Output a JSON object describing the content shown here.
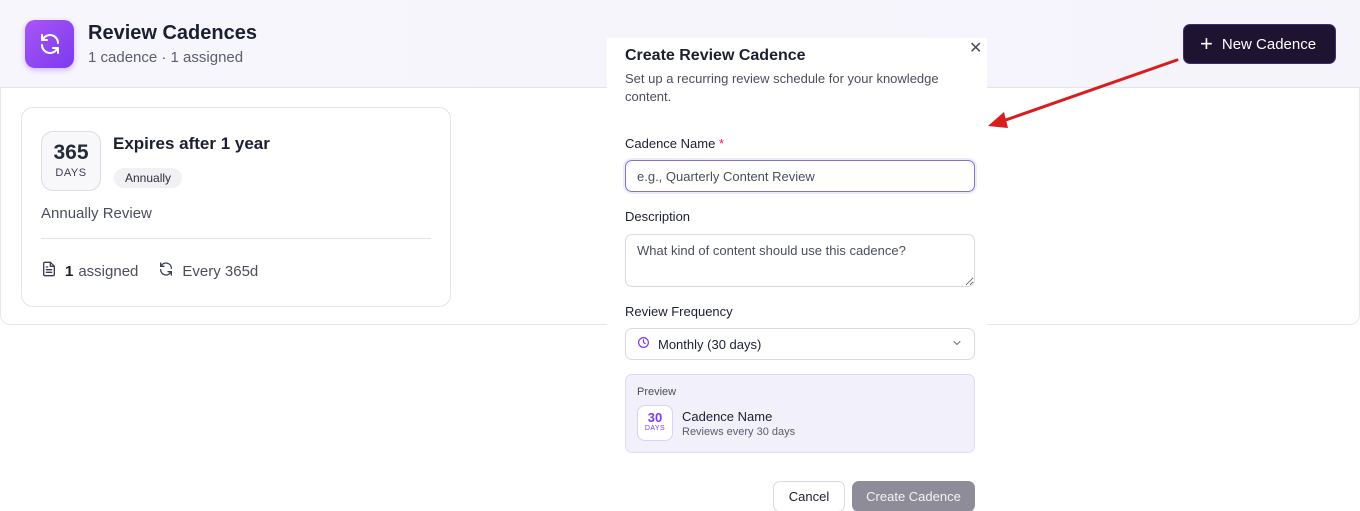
{
  "header": {
    "title": "Review Cadences",
    "subtitle": "1 cadence · 1 assigned",
    "new_button_label": "New Cadence"
  },
  "cadences": [
    {
      "days": "365",
      "days_unit": "DAYS",
      "title": "Expires after 1 year",
      "badge": "Annually",
      "description": "Annually Review",
      "assigned_count": "1",
      "assigned_label": "assigned",
      "frequency_text": "Every 365d"
    }
  ],
  "modal": {
    "title": "Create Review Cadence",
    "subtitle": "Set up a recurring review schedule for your knowledge content.",
    "name_label": "Cadence Name",
    "required_mark": "*",
    "name_placeholder": "e.g., Quarterly Content Review",
    "description_label": "Description",
    "description_placeholder": "What kind of content should use this cadence?",
    "frequency_label": "Review Frequency",
    "frequency_value": "Monthly (30 days)",
    "preview": {
      "label": "Preview",
      "days": "30",
      "days_unit": "DAYS",
      "name": "Cadence Name",
      "description": "Reviews every 30 days"
    },
    "cancel_label": "Cancel",
    "create_label": "Create Cadence"
  },
  "colors": {
    "accent": "#7c3aed",
    "primary_button": "#1e1330",
    "annotation_arrow": "#d91c1c",
    "disabled_button": "#8e8c99"
  }
}
